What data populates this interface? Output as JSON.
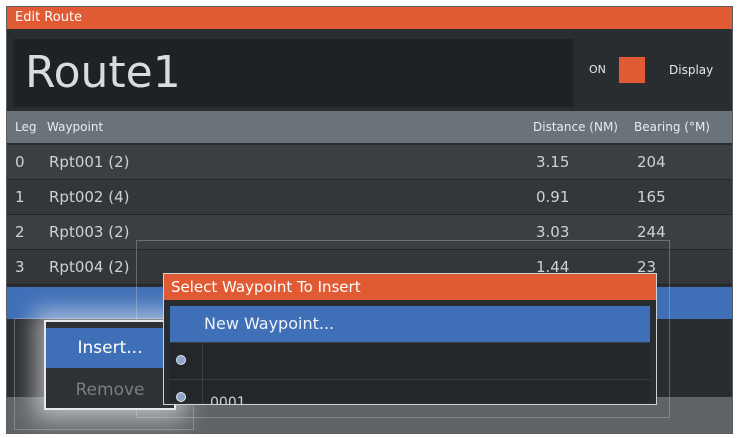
{
  "window": {
    "title": "Edit Route"
  },
  "route": {
    "name": "Route1"
  },
  "display_toggle": {
    "state_label": "ON",
    "label": "Display",
    "color": "#e05a33"
  },
  "table": {
    "headers": {
      "leg": "Leg",
      "waypoint": "Waypoint",
      "distance": "Distance (NM)",
      "bearing": "Bearing (°M)"
    },
    "rows": [
      {
        "leg": "0",
        "waypoint": "Rpt001 (2)",
        "distance": "3.15",
        "bearing": "204"
      },
      {
        "leg": "1",
        "waypoint": "Rpt002 (4)",
        "distance": "0.91",
        "bearing": "165"
      },
      {
        "leg": "2",
        "waypoint": "Rpt003 (2)",
        "distance": "3.03",
        "bearing": "244"
      },
      {
        "leg": "3",
        "waypoint": "Rpt004 (2)",
        "distance": "1.44",
        "bearing": "23"
      }
    ]
  },
  "context_menu": {
    "insert": "Insert...",
    "remove": "Remove"
  },
  "insert_dialog": {
    "title": "Select Waypoint To Insert",
    "items": [
      {
        "label": "New Waypoint...",
        "icon": ""
      },
      {
        "label": "",
        "icon": "waypoint-icon"
      },
      {
        "label": "0001",
        "icon": "waypoint-icon"
      }
    ]
  },
  "colors": {
    "accent": "#e05a33",
    "selection": "#3f6fb7"
  }
}
